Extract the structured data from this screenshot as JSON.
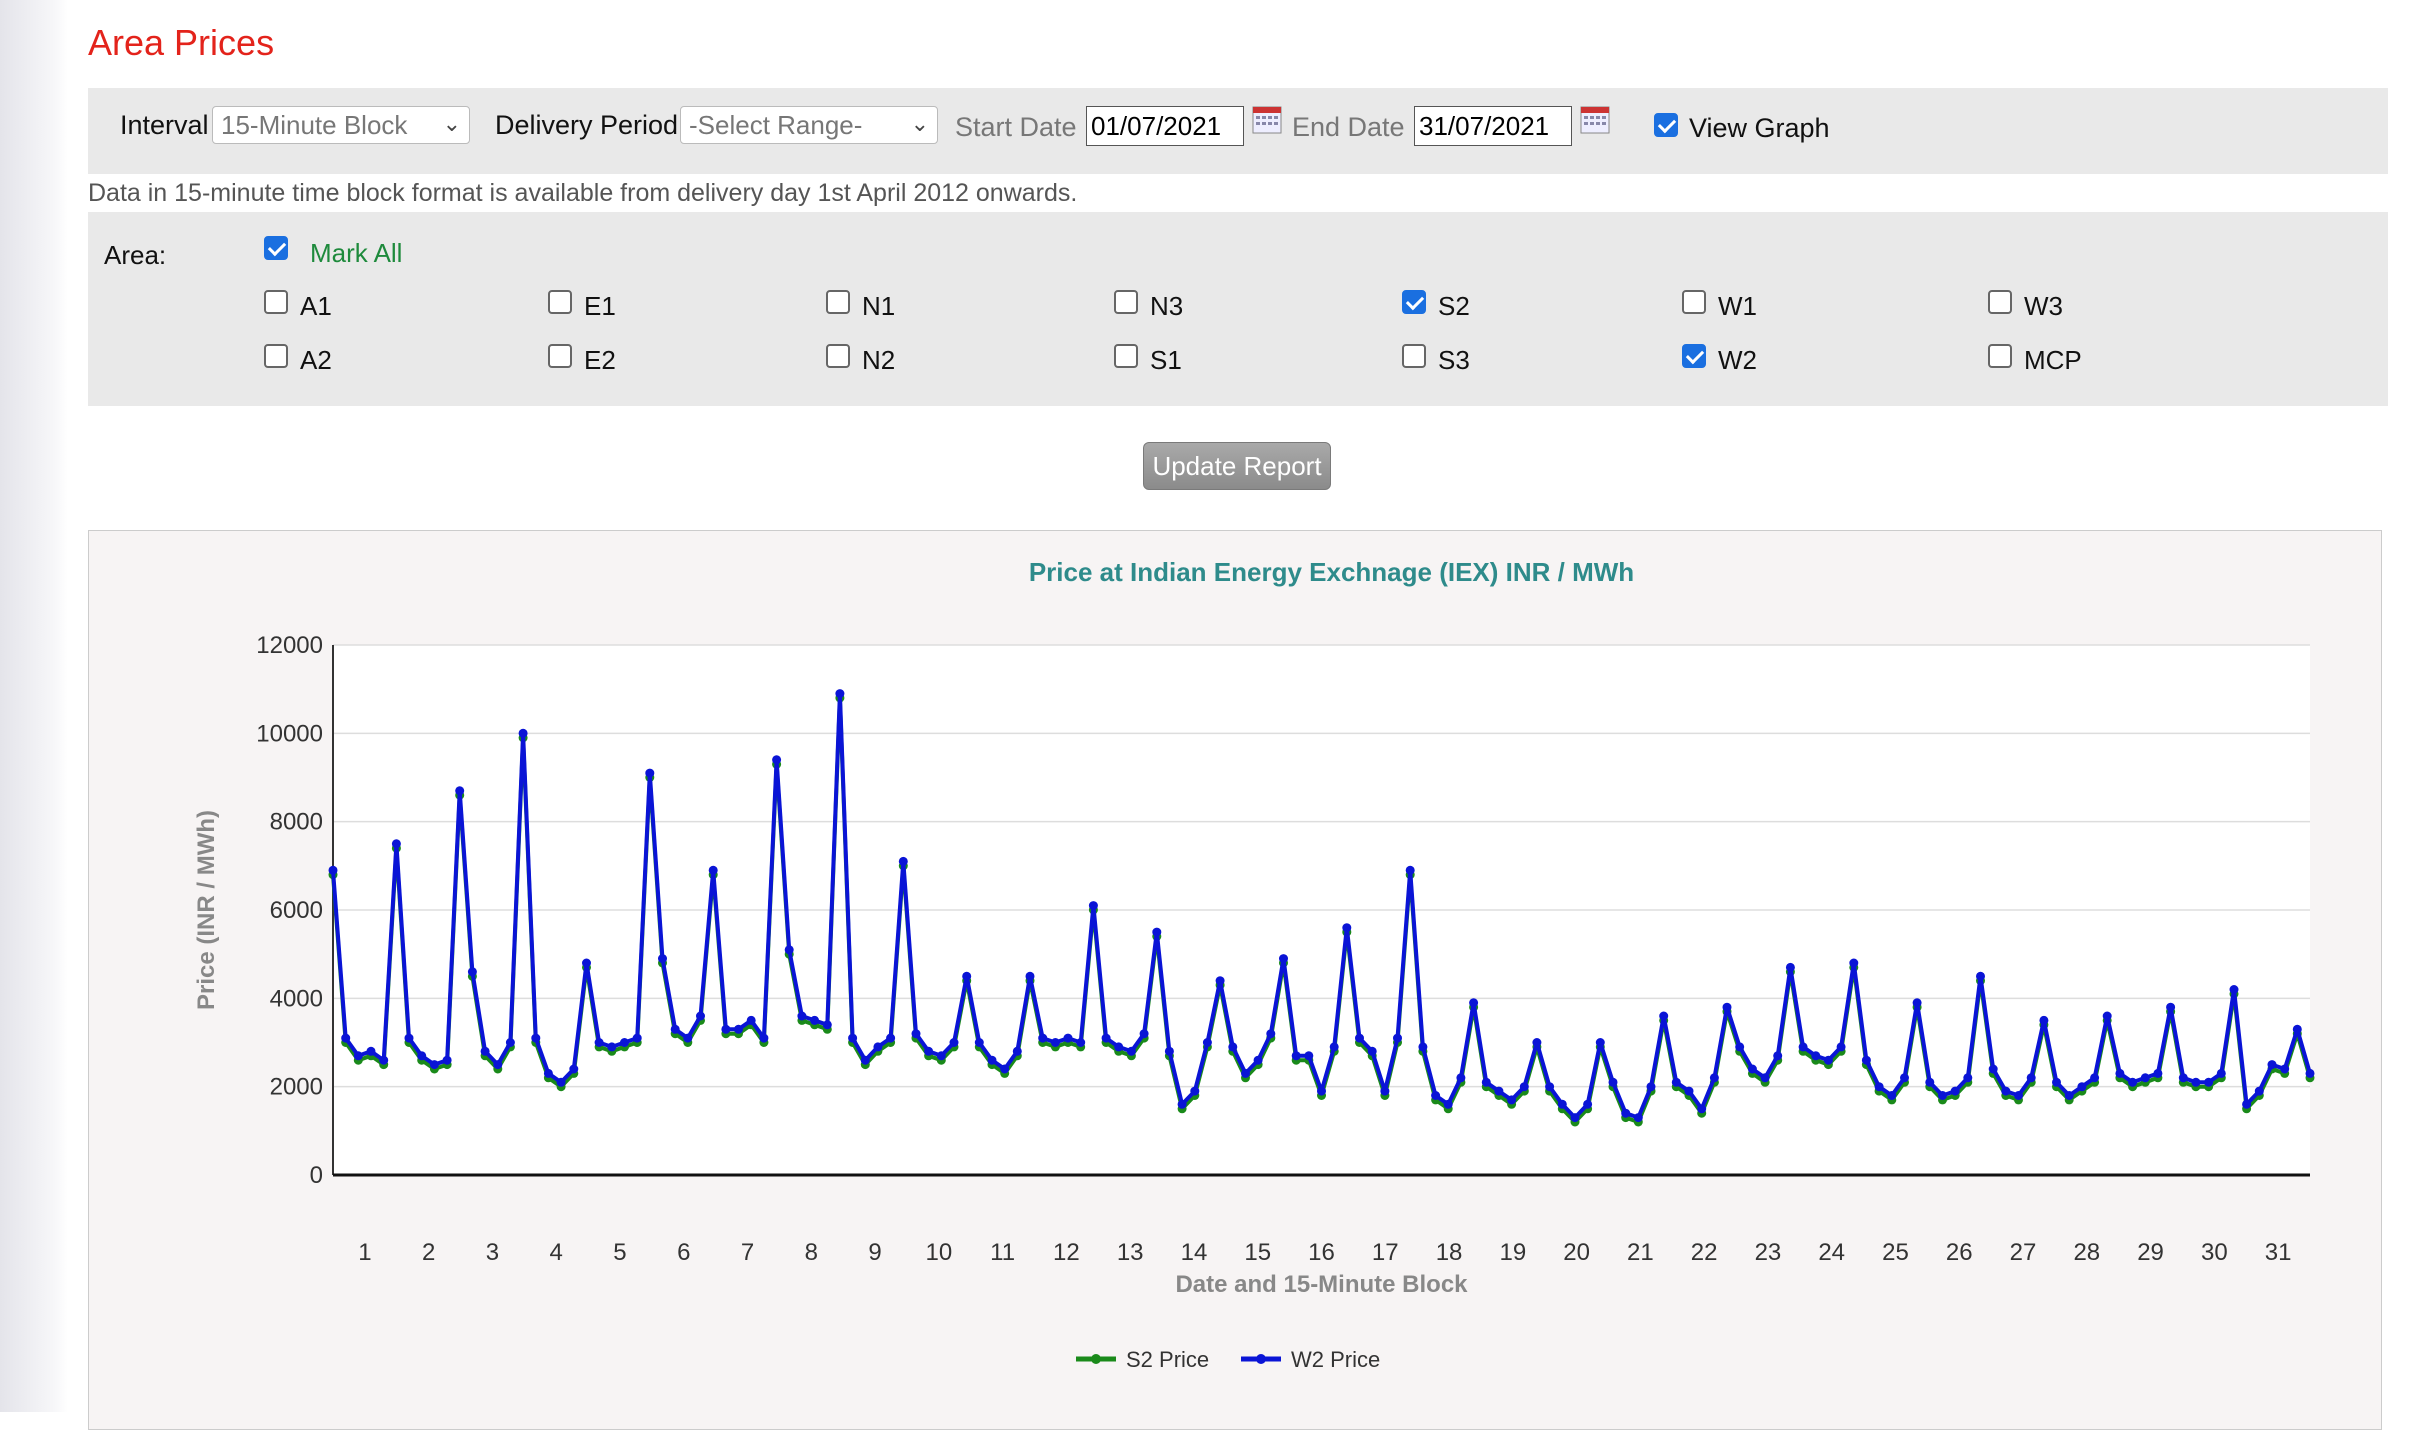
{
  "page": {
    "title": "Area Prices"
  },
  "filters": {
    "interval_label": "Interval",
    "interval_value": "15-Minute Block",
    "delivery_period_label": "Delivery Period",
    "delivery_period_value": "-Select Range-",
    "start_date_label": "Start Date",
    "start_date_value": "01/07/2021",
    "end_date_label": "End Date",
    "end_date_value": "31/07/2021",
    "view_graph_label": "View Graph",
    "view_graph_checked": true
  },
  "note": "Data in 15-minute time block format is available from delivery day 1st April 2012 onwards.",
  "area": {
    "label": "Area:",
    "mark_all_label": "Mark All",
    "mark_all_checked": true,
    "rows": [
      [
        {
          "label": "A1",
          "checked": false
        },
        {
          "label": "E1",
          "checked": false
        },
        {
          "label": "N1",
          "checked": false
        },
        {
          "label": "N3",
          "checked": false
        },
        {
          "label": "S2",
          "checked": true
        },
        {
          "label": "W1",
          "checked": false
        },
        {
          "label": "W3",
          "checked": false
        }
      ],
      [
        {
          "label": "A2",
          "checked": false
        },
        {
          "label": "E2",
          "checked": false
        },
        {
          "label": "N2",
          "checked": false
        },
        {
          "label": "S1",
          "checked": false
        },
        {
          "label": "S3",
          "checked": false
        },
        {
          "label": "W2",
          "checked": true
        },
        {
          "label": "MCP",
          "checked": false
        }
      ]
    ]
  },
  "update_button_label": "Update Report",
  "chart_data": {
    "type": "line",
    "title": "Price at Indian Energy Exchnage (IEX) INR / MWh",
    "xlabel": "Date and 15-Minute Block",
    "ylabel": "Price (INR / MWh)",
    "ylim": [
      0,
      12000
    ],
    "yticks": [
      0,
      2000,
      4000,
      6000,
      8000,
      10000,
      12000
    ],
    "xtick_labels": [
      "1",
      "2",
      "3",
      "4",
      "5",
      "6",
      "7",
      "8",
      "9",
      "10",
      "11",
      "12",
      "13",
      "14",
      "15",
      "16",
      "17",
      "18",
      "19",
      "20",
      "21",
      "22",
      "23",
      "24",
      "25",
      "26",
      "27",
      "28",
      "29",
      "30",
      "31"
    ],
    "colors": {
      "S2 Price": "#1a8a1a",
      "W2 Price": "#0a14d6"
    },
    "series": [
      {
        "name": "S2 Price",
        "values": [
          6800,
          3000,
          2600,
          2700,
          2500,
          7400,
          3000,
          2600,
          2400,
          2500,
          8600,
          4500,
          2700,
          2400,
          2900,
          9900,
          3000,
          2200,
          2000,
          2300,
          4700,
          2900,
          2800,
          2900,
          3000,
          9000,
          4800,
          3200,
          3000,
          3500,
          6800,
          3200,
          3200,
          3400,
          3000,
          9300,
          5000,
          3500,
          3400,
          3300,
          10800,
          3000,
          2500,
          2800,
          3000,
          7000,
          3100,
          2700,
          2600,
          2900,
          4400,
          2900,
          2500,
          2300,
          2700,
          4400,
          3000,
          2900,
          3000,
          2900,
          6000,
          3000,
          2800,
          2700,
          3100,
          5400,
          2700,
          1500,
          1800,
          2900,
          4300,
          2800,
          2200,
          2500,
          3100,
          4800,
          2600,
          2600,
          1800,
          2800,
          5500,
          3000,
          2700,
          1800,
          3000,
          6800,
          2800,
          1700,
          1500,
          2100,
          3800,
          2000,
          1800,
          1600,
          1900,
          2900,
          1900,
          1500,
          1200,
          1500,
          2900,
          2000,
          1300,
          1200,
          1900,
          3500,
          2000,
          1800,
          1400,
          2100,
          3700,
          2800,
          2300,
          2100,
          2600,
          4600,
          2800,
          2600,
          2500,
          2800,
          4700,
          2500,
          1900,
          1700,
          2100,
          3800,
          2000,
          1700,
          1800,
          2100,
          4400,
          2300,
          1800,
          1700,
          2100,
          3400,
          2000,
          1700,
          1900,
          2100,
          3500,
          2200,
          2000,
          2100,
          2200,
          3700,
          2100,
          2000,
          2000,
          2200,
          4100,
          1500,
          1800,
          2400,
          2300,
          3200,
          2200
        ]
      },
      {
        "name": "W2 Price",
        "values": [
          6900,
          3100,
          2700,
          2800,
          2600,
          7500,
          3100,
          2700,
          2500,
          2600,
          8700,
          4600,
          2800,
          2500,
          3000,
          10000,
          3100,
          2300,
          2100,
          2400,
          4800,
          3000,
          2900,
          3000,
          3100,
          9100,
          4900,
          3300,
          3100,
          3600,
          6900,
          3300,
          3300,
          3500,
          3100,
          9400,
          5100,
          3600,
          3500,
          3400,
          10900,
          3100,
          2600,
          2900,
          3100,
          7100,
          3200,
          2800,
          2700,
          3000,
          4500,
          3000,
          2600,
          2400,
          2800,
          4500,
          3100,
          3000,
          3100,
          3000,
          6100,
          3100,
          2900,
          2800,
          3200,
          5500,
          2800,
          1600,
          1900,
          3000,
          4400,
          2900,
          2300,
          2600,
          3200,
          4900,
          2700,
          2700,
          1900,
          2900,
          5600,
          3100,
          2800,
          1900,
          3100,
          6900,
          2900,
          1800,
          1600,
          2200,
          3900,
          2100,
          1900,
          1700,
          2000,
          3000,
          2000,
          1600,
          1300,
          1600,
          3000,
          2100,
          1400,
          1300,
          2000,
          3600,
          2100,
          1900,
          1500,
          2200,
          3800,
          2900,
          2400,
          2200,
          2700,
          4700,
          2900,
          2700,
          2600,
          2900,
          4800,
          2600,
          2000,
          1800,
          2200,
          3900,
          2100,
          1800,
          1900,
          2200,
          4500,
          2400,
          1900,
          1800,
          2200,
          3500,
          2100,
          1800,
          2000,
          2200,
          3600,
          2300,
          2100,
          2200,
          2300,
          3800,
          2200,
          2100,
          2100,
          2300,
          4200,
          1600,
          1900,
          2500,
          2400,
          3300,
          2300
        ]
      }
    ],
    "legend_position": "bottom"
  }
}
